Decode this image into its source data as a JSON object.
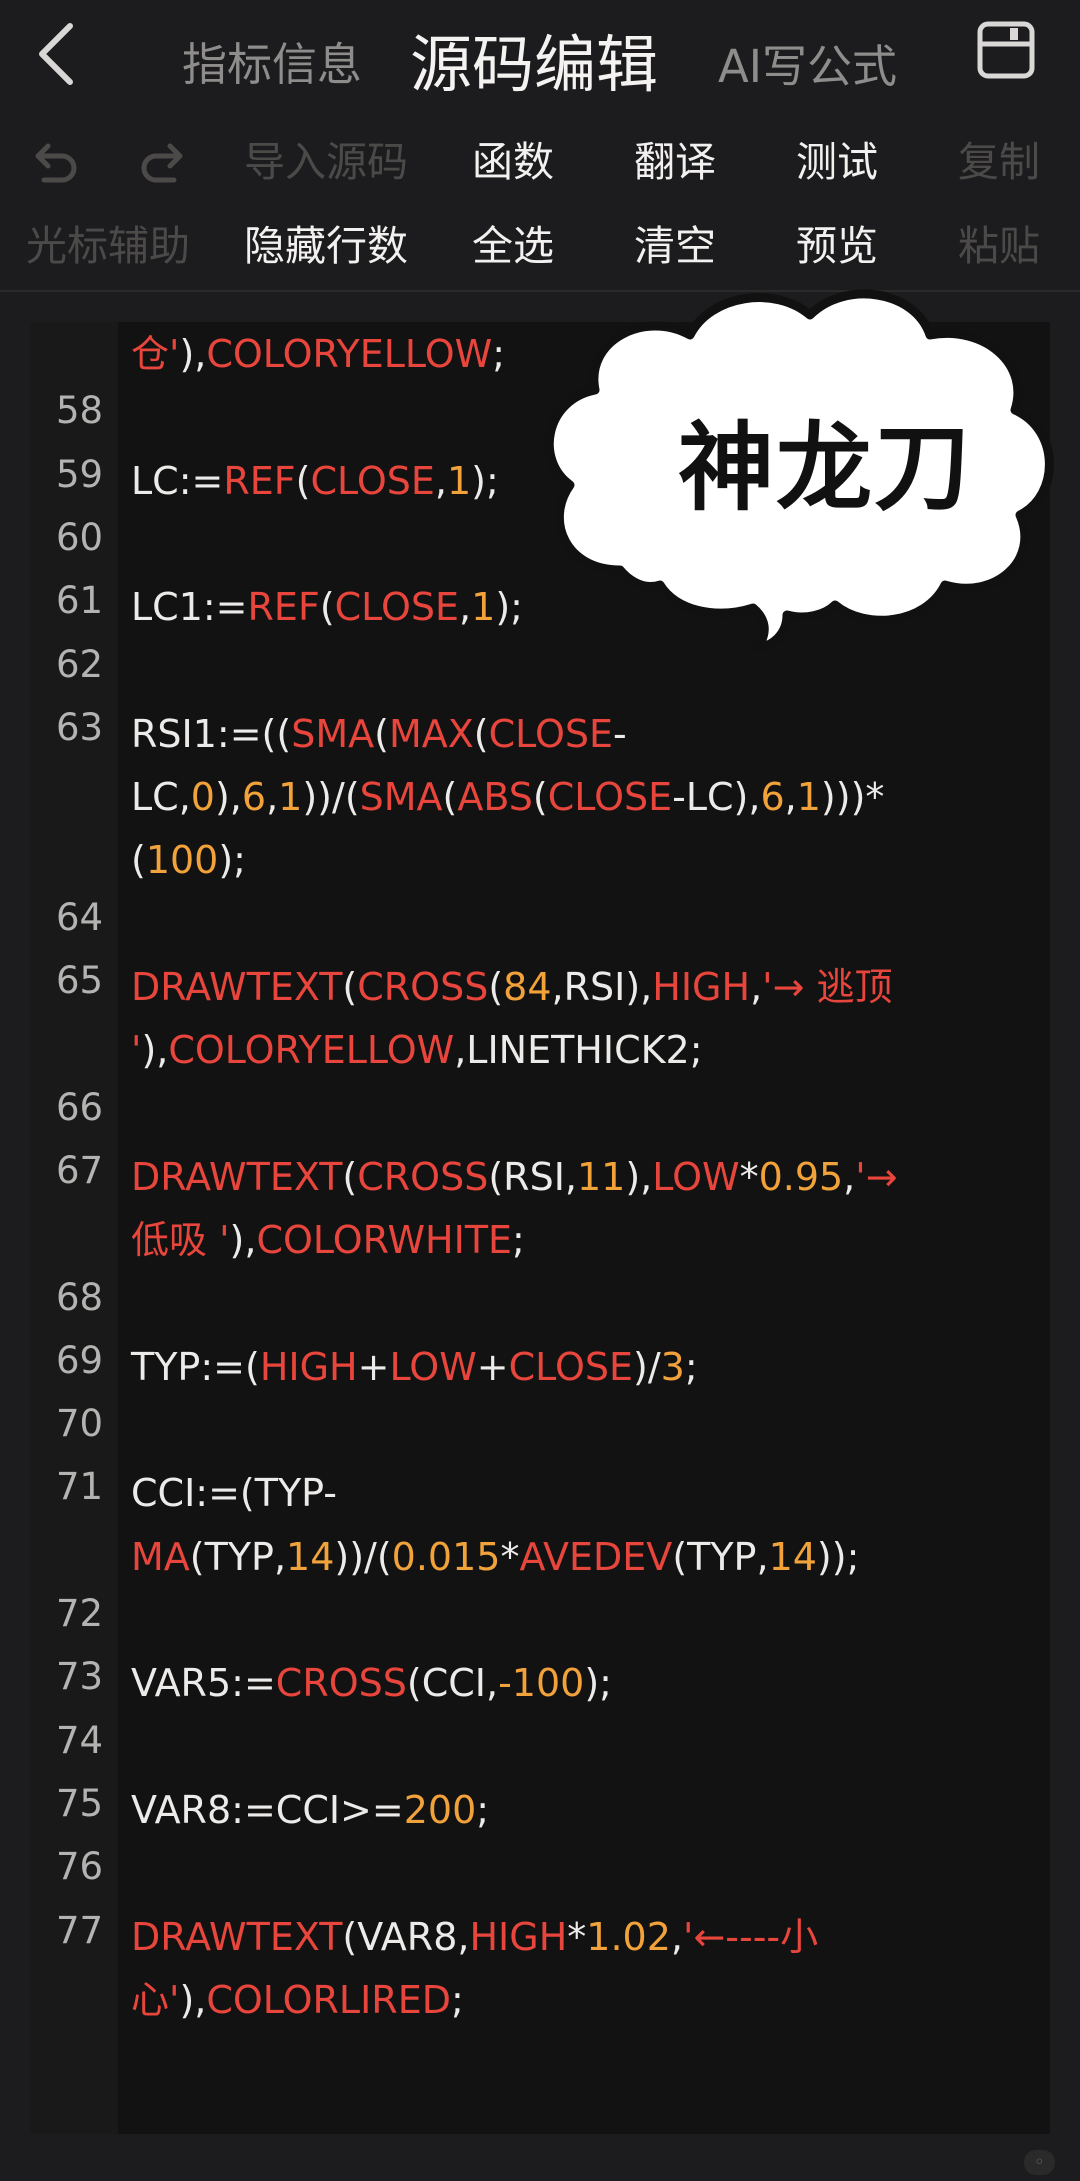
{
  "nav": {
    "tab_info": "指标信息",
    "tab_source": "源码编辑",
    "tab_ai": "AI写公式"
  },
  "toolbar": {
    "row1": [
      "导入源码",
      "函数",
      "翻译",
      "测试",
      "复制"
    ],
    "row2": [
      "光标辅助",
      "隐藏行数",
      "全选",
      "清空",
      "预览",
      "粘贴"
    ],
    "icons": [
      "undo-icon",
      "redo-icon",
      "save-icon",
      "back-chevron-icon"
    ]
  },
  "sticker": {
    "text": "神龙刀"
  },
  "colors": {
    "function": "#e8453c",
    "number": "#f2a23a",
    "text": "#ecebe9",
    "background": "#121212"
  },
  "code_lines": [
    {
      "ln": "",
      "tokens": [
        [
          "s",
          "仓'"
        ],
        [
          "t",
          "),"
        ],
        [
          "f",
          "COLORYELLOW"
        ],
        [
          "t",
          ";"
        ]
      ]
    },
    {
      "ln": "58",
      "tokens": []
    },
    {
      "ln": "59",
      "tokens": [
        [
          "t",
          "LC:="
        ],
        [
          "f",
          "REF"
        ],
        [
          "t",
          "("
        ],
        [
          "f",
          "CLOSE"
        ],
        [
          "t",
          ","
        ],
        [
          "n",
          "1"
        ],
        [
          "t",
          ");"
        ]
      ]
    },
    {
      "ln": "60",
      "tokens": []
    },
    {
      "ln": "61",
      "tokens": [
        [
          "t",
          "LC1:="
        ],
        [
          "f",
          "REF"
        ],
        [
          "t",
          "("
        ],
        [
          "f",
          "CLOSE"
        ],
        [
          "t",
          ","
        ],
        [
          "n",
          "1"
        ],
        [
          "t",
          ");"
        ]
      ]
    },
    {
      "ln": "62",
      "tokens": []
    },
    {
      "ln": "63",
      "tokens": [
        [
          "t",
          "RSI1:=(("
        ],
        [
          "f",
          "SMA"
        ],
        [
          "t",
          "("
        ],
        [
          "f",
          "MAX"
        ],
        [
          "t",
          "("
        ],
        [
          "f",
          "CLOSE"
        ],
        [
          "t",
          "-"
        ]
      ]
    },
    {
      "ln": "",
      "tokens": [
        [
          "t",
          "LC,"
        ],
        [
          "n",
          "0"
        ],
        [
          "t",
          "),"
        ],
        [
          "n",
          "6"
        ],
        [
          "t",
          ","
        ],
        [
          "n",
          "1"
        ],
        [
          "t",
          "))/("
        ],
        [
          "f",
          "SMA"
        ],
        [
          "t",
          "("
        ],
        [
          "f",
          "ABS"
        ],
        [
          "t",
          "("
        ],
        [
          "f",
          "CLOSE"
        ],
        [
          "t",
          "-LC),"
        ],
        [
          "n",
          "6"
        ],
        [
          "t",
          ","
        ],
        [
          "n",
          "1"
        ],
        [
          "t",
          ")))*"
        ]
      ]
    },
    {
      "ln": "",
      "tokens": [
        [
          "t",
          "("
        ],
        [
          "n",
          "100"
        ],
        [
          "t",
          ");"
        ]
      ]
    },
    {
      "ln": "64",
      "tokens": []
    },
    {
      "ln": "65",
      "tokens": [
        [
          "f",
          "DRAWTEXT"
        ],
        [
          "t",
          "("
        ],
        [
          "f",
          "CROSS"
        ],
        [
          "t",
          "("
        ],
        [
          "n",
          "84"
        ],
        [
          "t",
          ",RSI),"
        ],
        [
          "f",
          "HIGH"
        ],
        [
          "t",
          ","
        ],
        [
          "s",
          "'→ 逃顶"
        ]
      ]
    },
    {
      "ln": "",
      "tokens": [
        [
          "s",
          "'"
        ],
        [
          "t",
          "),"
        ],
        [
          "f",
          "COLORYELLOW"
        ],
        [
          "t",
          ",LINETHICK2;"
        ]
      ]
    },
    {
      "ln": "66",
      "tokens": []
    },
    {
      "ln": "67",
      "tokens": [
        [
          "f",
          "DRAWTEXT"
        ],
        [
          "t",
          "("
        ],
        [
          "f",
          "CROSS"
        ],
        [
          "t",
          "(RSI,"
        ],
        [
          "n",
          "11"
        ],
        [
          "t",
          "),"
        ],
        [
          "f",
          "LOW"
        ],
        [
          "t",
          "*"
        ],
        [
          "n",
          "0.95"
        ],
        [
          "t",
          ","
        ],
        [
          "s",
          "'→"
        ]
      ]
    },
    {
      "ln": "",
      "tokens": [
        [
          "s",
          "低吸 '"
        ],
        [
          "t",
          "),"
        ],
        [
          "f",
          "COLORWHITE"
        ],
        [
          "t",
          ";"
        ]
      ]
    },
    {
      "ln": "68",
      "tokens": []
    },
    {
      "ln": "69",
      "tokens": [
        [
          "t",
          "TYP:=("
        ],
        [
          "f",
          "HIGH"
        ],
        [
          "t",
          "+"
        ],
        [
          "f",
          "LOW"
        ],
        [
          "t",
          "+"
        ],
        [
          "f",
          "CLOSE"
        ],
        [
          "t",
          ")/"
        ],
        [
          "n",
          "3"
        ],
        [
          "t",
          ";"
        ]
      ]
    },
    {
      "ln": "70",
      "tokens": []
    },
    {
      "ln": "71",
      "tokens": [
        [
          "t",
          "CCI:=(TYP-"
        ]
      ]
    },
    {
      "ln": "",
      "tokens": [
        [
          "f",
          "MA"
        ],
        [
          "t",
          "(TYP,"
        ],
        [
          "n",
          "14"
        ],
        [
          "t",
          "))/("
        ],
        [
          "n",
          "0.015"
        ],
        [
          "t",
          "*"
        ],
        [
          "f",
          "AVEDEV"
        ],
        [
          "t",
          "(TYP,"
        ],
        [
          "n",
          "14"
        ],
        [
          "t",
          "));"
        ]
      ]
    },
    {
      "ln": "72",
      "tokens": []
    },
    {
      "ln": "73",
      "tokens": [
        [
          "t",
          "VAR5:="
        ],
        [
          "f",
          "CROSS"
        ],
        [
          "t",
          "(CCI,"
        ],
        [
          "n",
          "-100"
        ],
        [
          "t",
          ");"
        ]
      ]
    },
    {
      "ln": "74",
      "tokens": []
    },
    {
      "ln": "75",
      "tokens": [
        [
          "t",
          "VAR8:=CCI>="
        ],
        [
          "n",
          "200"
        ],
        [
          "t",
          ";"
        ]
      ]
    },
    {
      "ln": "76",
      "tokens": []
    },
    {
      "ln": "77",
      "tokens": [
        [
          "f",
          "DRAWTEXT"
        ],
        [
          "t",
          "(VAR8,"
        ],
        [
          "f",
          "HIGH"
        ],
        [
          "t",
          "*"
        ],
        [
          "n",
          "1.02"
        ],
        [
          "t",
          ","
        ],
        [
          "s",
          "'←----小"
        ]
      ]
    },
    {
      "ln": "",
      "tokens": [
        [
          "s",
          "心'"
        ],
        [
          "t",
          "),"
        ],
        [
          "f",
          "COLORLIRED"
        ],
        [
          "t",
          ";"
        ]
      ]
    }
  ]
}
